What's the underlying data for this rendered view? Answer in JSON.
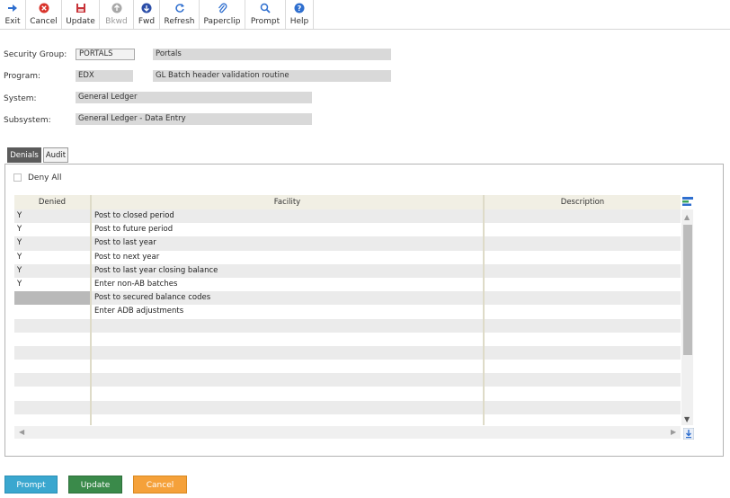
{
  "toolbar": {
    "buttons": [
      {
        "label": "Exit",
        "icon": "exit-arrow-icon"
      },
      {
        "label": "Cancel",
        "icon": "cancel-x-icon"
      },
      {
        "label": "Update",
        "icon": "save-disk-icon"
      },
      {
        "label": "Bkwd",
        "icon": "arrow-up-icon"
      },
      {
        "label": "Fwd",
        "icon": "arrow-down-icon"
      },
      {
        "label": "Refresh",
        "icon": "refresh-icon"
      },
      {
        "label": "Paperclip",
        "icon": "paperclip-icon"
      },
      {
        "label": "Prompt",
        "icon": "magnifier-icon"
      },
      {
        "label": "Help",
        "icon": "help-icon"
      }
    ]
  },
  "header": {
    "security_group_label": "Security Group:",
    "security_group_code": "PORTALS",
    "security_group_desc": "Portals",
    "program_label": "Program:",
    "program_code": "EDX",
    "program_desc": "GL Batch header validation routine",
    "system_label": "System:",
    "system_value": "General Ledger",
    "subsystem_label": "Subsystem:",
    "subsystem_value": "General Ledger - Data Entry"
  },
  "tabs": [
    {
      "label": "Denials"
    },
    {
      "label": "Audit"
    }
  ],
  "deny_all_label": "Deny All",
  "grid": {
    "columns": [
      "Denied",
      "Facility",
      "Description"
    ],
    "rows": [
      {
        "denied": "Y",
        "facility": "Post to closed period",
        "description": ""
      },
      {
        "denied": "Y",
        "facility": "Post to future period",
        "description": ""
      },
      {
        "denied": "Y",
        "facility": "Post to last year",
        "description": ""
      },
      {
        "denied": "Y",
        "facility": "Post to next year",
        "description": ""
      },
      {
        "denied": "Y",
        "facility": "Post to last year closing balance",
        "description": ""
      },
      {
        "denied": "Y",
        "facility": "Enter non-AB batches",
        "description": ""
      },
      {
        "denied": "",
        "facility": "Post to secured balance codes",
        "description": ""
      },
      {
        "denied": "",
        "facility": "Enter ADB adjustments",
        "description": ""
      },
      {
        "denied": "",
        "facility": "",
        "description": ""
      },
      {
        "denied": "",
        "facility": "",
        "description": ""
      },
      {
        "denied": "",
        "facility": "",
        "description": ""
      },
      {
        "denied": "",
        "facility": "",
        "description": ""
      },
      {
        "denied": "",
        "facility": "",
        "description": ""
      },
      {
        "denied": "",
        "facility": "",
        "description": ""
      },
      {
        "denied": "",
        "facility": "",
        "description": ""
      },
      {
        "denied": "",
        "facility": "",
        "description": ""
      }
    ]
  },
  "buttons": {
    "prompt": "Prompt",
    "update": "Update",
    "cancel": "Cancel"
  },
  "colors": {
    "prompt": "#3aa7cf",
    "update": "#3a8a4a",
    "cancel": "#f5a13a",
    "active_tab": "#5b5b5b"
  }
}
